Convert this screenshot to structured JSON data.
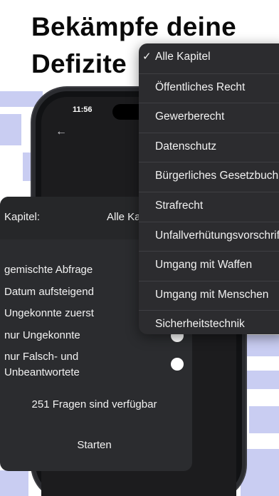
{
  "headline": {
    "line1": "Bekämpfe deine",
    "line2": "Defizite"
  },
  "phone": {
    "status_time": "11:56"
  },
  "settings": {
    "chapter_label": "Kapitel:",
    "chapter_value": "Alle Ka",
    "options": [
      "gemischte Abfrage",
      "Datum aufsteigend",
      "Ungekonnte zuerst",
      "nur Ungekonnte",
      "nur Falsch- und Unbeantwortete"
    ],
    "available_text": "251 Fragen sind verfügbar",
    "start_label": "Starten"
  },
  "menu": {
    "selected_index": 0,
    "checkmark": "✓",
    "items": [
      "Alle Kapitel",
      "Öffentliches Recht",
      "Gewerberecht",
      "Datenschutz",
      "Bürgerliches Gesetzbuch",
      "Strafrecht",
      "Unfallverhütungsvorschrift",
      "Umgang mit Waffen",
      "Umgang mit Menschen",
      "Sicherheitstechnik"
    ]
  },
  "colors": {
    "background": "#ffffff",
    "pattern": "#c9cdf2",
    "card": "#2b2c2f",
    "menu": "#2c2c2f",
    "text_light": "#f2f2f2"
  }
}
